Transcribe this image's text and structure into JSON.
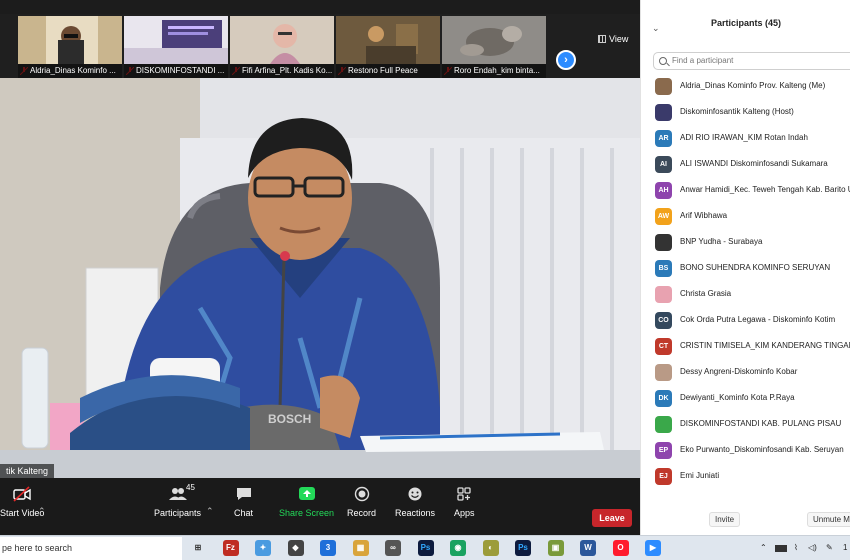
{
  "meeting": {
    "thumbnails": [
      {
        "name": "Aldria_Dinas Kominfo ...",
        "bg": "#c9b58e"
      },
      {
        "name": "DISKOMINFOSTANDI ...",
        "bg": "#5a4f86"
      },
      {
        "name": "Fifi Arfina_Plt. Kadis Ko...",
        "bg": "#c4b7a6"
      },
      {
        "name": "Restono Full Peace",
        "bg": "#6b5a43"
      },
      {
        "name": "Roro Endah_kim binta...",
        "bg": "#8d8a86"
      }
    ],
    "next_glyph": "›",
    "view_label": "View",
    "speaker_name": "tik Kalteng"
  },
  "toolbar": {
    "start_video": "Start Video",
    "participants": "Participants",
    "participants_count": "45",
    "chat": "Chat",
    "share_screen": "Share Screen",
    "record": "Record",
    "reactions": "Reactions",
    "apps": "Apps",
    "leave": "Leave"
  },
  "panel": {
    "title": "Participants (45)",
    "search_placeholder": "Find a participant",
    "participants": [
      {
        "initials": "",
        "name": "Aldria_Dinas Kominfo Prov. Kalteng (Me)",
        "color": "#8a6a4d",
        "photo": true
      },
      {
        "initials": "",
        "name": "Diskominfosantik Kalteng (Host)",
        "color": "#3a3a6a",
        "photo": true
      },
      {
        "initials": "AR",
        "name": "ADI RIO IRAWAN_KIM Rotan Indah",
        "color": "#2b7ab8",
        "photo": false
      },
      {
        "initials": "AI",
        "name": "ALI ISWANDI Diskominfosandi Sukamara",
        "color": "#3b4a5a",
        "photo": false
      },
      {
        "initials": "AH",
        "name": "Anwar Hamidi_Kec. Teweh Tengah Kab. Barito Ut",
        "color": "#8e44ad",
        "photo": false
      },
      {
        "initials": "AW",
        "name": "Arif Wibhawa",
        "color": "#f2a21b",
        "photo": false
      },
      {
        "initials": "",
        "name": "BNP Yudha - Surabaya",
        "color": "#333333",
        "photo": true
      },
      {
        "initials": "BS",
        "name": "BONO SUHENDRA KOMINFO SERUYAN",
        "color": "#2b7ab8",
        "photo": false
      },
      {
        "initials": "",
        "name": "Christa Grasia",
        "color": "#e8a2b0",
        "photo": true
      },
      {
        "initials": "CO",
        "name": "Cok Orda Putra Legawa - Diskominfo Kotim",
        "color": "#34495e",
        "photo": false
      },
      {
        "initials": "CT",
        "name": "CRISTIN TIMISELA_KIM KANDERANG TINGANG",
        "color": "#c0392b",
        "photo": false
      },
      {
        "initials": "",
        "name": "Dessy Angreni-Diskominfo Kobar",
        "color": "#b99a86",
        "photo": true
      },
      {
        "initials": "DK",
        "name": "Dewiyanti_Kominfo Kota P.Raya",
        "color": "#2b7ab8",
        "photo": false
      },
      {
        "initials": "",
        "name": "DISKOMINFOSTANDI KAB. PULANG PISAU",
        "color": "#3aa84a",
        "photo": true
      },
      {
        "initials": "EP",
        "name": "Eko Purwanto_Diskominfosandi Kab. Seruyan",
        "color": "#8e44ad",
        "photo": false
      },
      {
        "initials": "EJ",
        "name": "Emi Juniati",
        "color": "#c0392b",
        "photo": false
      }
    ],
    "invite": "Invite",
    "unmute": "Unmute Me"
  },
  "taskbar": {
    "search_text": "pe here to search",
    "apps": [
      {
        "label": "⊞",
        "color": "#dfe6ee",
        "fg": "#333"
      },
      {
        "label": "Fz",
        "color": "#bf2d23",
        "fg": "#fff"
      },
      {
        "label": "✦",
        "color": "#4a9be0",
        "fg": "#fff"
      },
      {
        "label": "◆",
        "color": "#444",
        "fg": "#fff"
      },
      {
        "label": "3",
        "color": "#1e6fd9",
        "fg": "#fff"
      },
      {
        "label": "▦",
        "color": "#d9a43b",
        "fg": "#fff"
      },
      {
        "label": "∞",
        "color": "#555",
        "fg": "#fff"
      },
      {
        "label": "Ps",
        "color": "#0d1b3e",
        "fg": "#31a8ff"
      },
      {
        "label": "◉",
        "color": "#1aa260",
        "fg": "#fff"
      },
      {
        "label": "◐",
        "color": "#9c9c3a",
        "fg": "#fff"
      },
      {
        "label": "Ps",
        "color": "#0d1b3e",
        "fg": "#31a8ff"
      },
      {
        "label": "▣",
        "color": "#7a9a3a",
        "fg": "#fff"
      },
      {
        "label": "W",
        "color": "#2b579a",
        "fg": "#fff"
      },
      {
        "label": "O",
        "color": "#ff1b2d",
        "fg": "#fff"
      },
      {
        "label": "▶",
        "color": "#2d8cff",
        "fg": "#fff"
      }
    ],
    "clock": "1"
  }
}
